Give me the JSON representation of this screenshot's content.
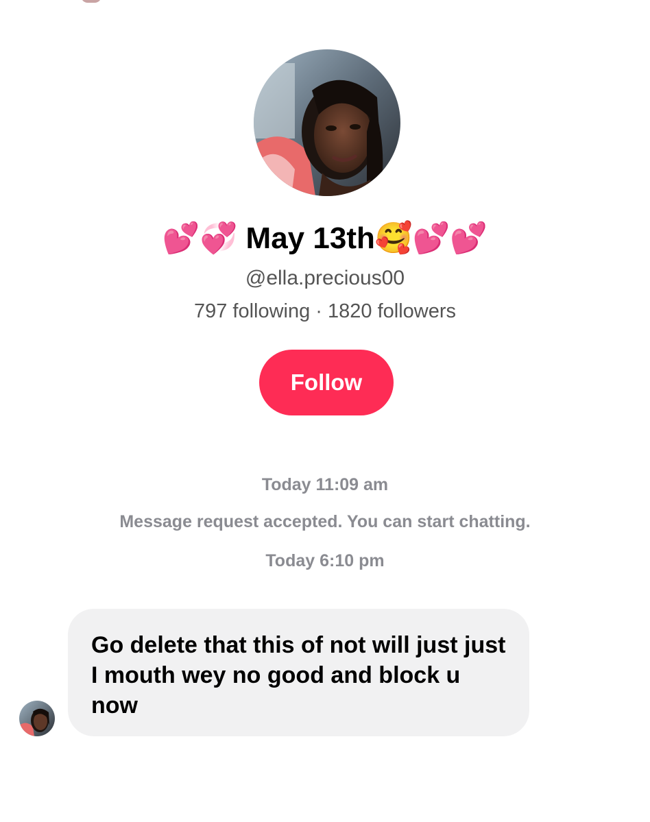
{
  "profile": {
    "display_name": "💕💞 May 13th🥰💕💕",
    "username": "@ella.precious00",
    "following_count": "797",
    "following_label": "following",
    "separator": " · ",
    "followers_count": "1820",
    "followers_label": "followers",
    "avatar_icon": "profile-photo"
  },
  "actions": {
    "follow_label": "Follow"
  },
  "chat": {
    "timestamp_1": "Today 11:09 am",
    "system_message": "Message request accepted. You can start chatting.",
    "timestamp_2": "Today 6:10 pm",
    "messages": [
      {
        "text": "Go delete that this of not will just just I mouth wey no good and block u now"
      }
    ]
  },
  "colors": {
    "accent": "#fe2c55",
    "bubble_bg": "#f1f1f2",
    "muted_text": "#8a8b91",
    "secondary_text": "#545454"
  }
}
